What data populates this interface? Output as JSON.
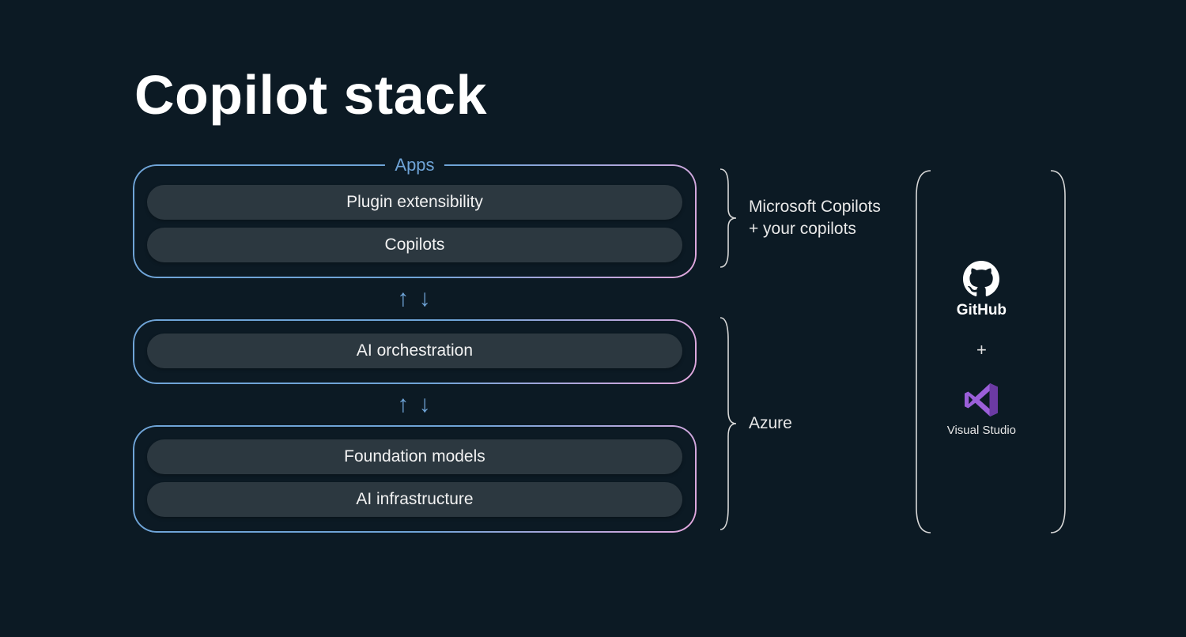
{
  "title": "Copilot stack",
  "layers": [
    {
      "label": "Apps",
      "pills": [
        "Plugin extensibility",
        "Copilots"
      ]
    },
    {
      "label": "",
      "pills": [
        "AI orchestration"
      ]
    },
    {
      "label": "",
      "pills": [
        "Foundation models",
        "AI infrastructure"
      ]
    }
  ],
  "annotations": {
    "top_group": "Microsoft Copilots\n+ your copilots",
    "bottom_group": "Azure"
  },
  "tools": {
    "github_label": "GitHub",
    "plus": "+",
    "vs_label": "Visual Studio"
  },
  "arrows_glyph": "↑ ↓"
}
